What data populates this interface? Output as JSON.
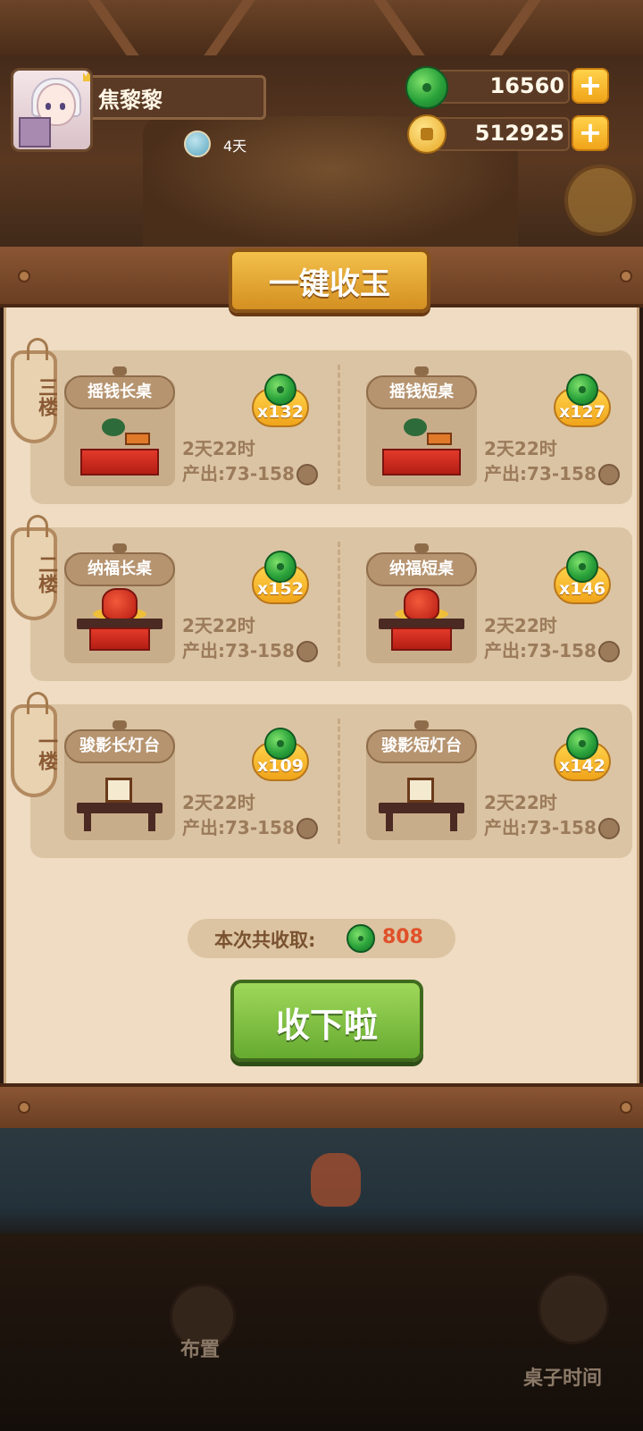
{
  "player": {
    "name": "焦黎黎",
    "days": "4天"
  },
  "resources": {
    "jade": "16560",
    "coins": "512925"
  },
  "side_button": {
    "icon": "通"
  },
  "panel": {
    "title": "一键收玉",
    "rows": [
      {
        "floor": "三楼",
        "items": [
          {
            "name": "摇钱长桌",
            "count": "x132",
            "time": "2天22时",
            "output": "产出:73-158"
          },
          {
            "name": "摇钱短桌",
            "count": "x127",
            "time": "2天22时",
            "output": "产出:73-158"
          }
        ]
      },
      {
        "floor": "二楼",
        "items": [
          {
            "name": "纳福长桌",
            "count": "x152",
            "time": "2天22时",
            "output": "产出:73-158"
          },
          {
            "name": "纳福短桌",
            "count": "x146",
            "time": "2天22时",
            "output": "产出:73-158"
          }
        ]
      },
      {
        "floor": "一楼",
        "items": [
          {
            "name": "骏影长灯台",
            "count": "x109",
            "time": "2天22时",
            "output": "产出:73-158"
          },
          {
            "name": "骏影短灯台",
            "count": "x142",
            "time": "2天22时",
            "output": "产出:73-158"
          }
        ]
      }
    ],
    "total_label": "本次共收取:",
    "total_value": "808",
    "collect_button": "收下啦"
  },
  "bottom": {
    "layout_label": "布置",
    "table_time_label": "桌子时间"
  },
  "colors": {
    "accent_green": "#66aa30",
    "accent_gold": "#f0a41a",
    "total_value": "#e0502a"
  }
}
